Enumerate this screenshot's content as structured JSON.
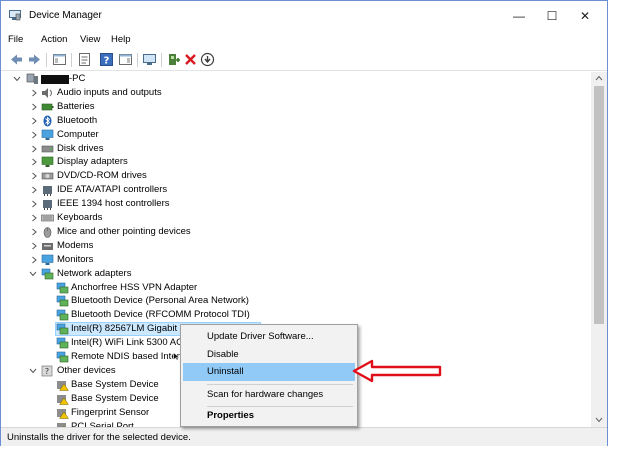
{
  "window": {
    "title": "Device Manager"
  },
  "menubar": {
    "items": [
      "File",
      "Action",
      "View",
      "Help"
    ]
  },
  "toolbar": {
    "buttons": [
      "back-icon",
      "forward-icon",
      "show-hide-tree-icon",
      "properties-icon",
      "help-icon",
      "action-pane-icon",
      "monitor-icon",
      "scan-hardware-icon",
      "uninstall-icon",
      "update-driver-icon"
    ]
  },
  "tree": {
    "root_label": "-PC",
    "categories_top": [
      "Audio inputs and outputs",
      "Batteries",
      "Bluetooth",
      "Computer",
      "Disk drives",
      "Display adapters",
      "DVD/CD-ROM drives",
      "IDE ATA/ATAPI controllers",
      "IEEE 1394 host controllers",
      "Keyboards",
      "Mice and other pointing devices",
      "Modems",
      "Monitors",
      "Network adapters"
    ],
    "network_children": [
      "Anchorfree HSS VPN Adapter",
      "Bluetooth Device (Personal Area Network)",
      "Bluetooth Device (RFCOMM Protocol TDI)",
      "Intel(R) 82567LM Gigabit Network Connection",
      "Intel(R) WiFi Link 5300 AGN",
      "Remote NDIS based Internet Sharing Device"
    ],
    "other_label": "Other devices",
    "other_children": [
      "Base System Device",
      "Base System Device",
      "Fingerprint Sensor",
      "PCI Serial Port"
    ]
  },
  "context_menu": {
    "items": [
      "Update Driver Software...",
      "Disable",
      "Uninstall",
      "Scan for hardware changes",
      "Properties"
    ],
    "highlighted": "Uninstall"
  },
  "status": {
    "text": "Uninstalls the driver for the selected device."
  },
  "colors": {
    "selection": "#cce8ff",
    "menu_highlight": "#91c9f7",
    "arrow": "#e0101a"
  }
}
